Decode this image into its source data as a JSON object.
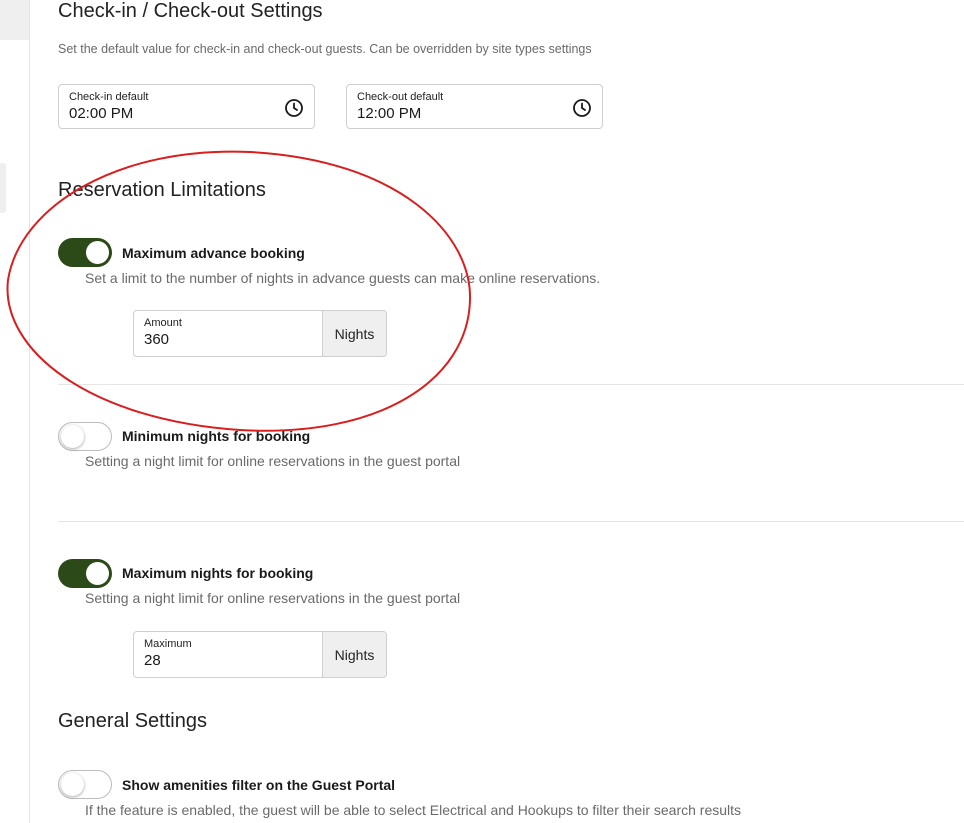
{
  "checkin_section": {
    "title": "Check-in / Check-out Settings",
    "description": "Set the default value for check-in and check-out guests. Can be overridden by site types settings",
    "checkin": {
      "label": "Check-in default",
      "value": "02:00 PM"
    },
    "checkout": {
      "label": "Check-out default",
      "value": "12:00 PM"
    }
  },
  "reservation_section": {
    "title": "Reservation Limitations",
    "max_advance": {
      "label": "Maximum advance booking",
      "description": "Set a limit to the number of nights in advance guests can make online reservations.",
      "enabled": true,
      "field_label": "Amount",
      "field_value": "360",
      "suffix": "Nights"
    },
    "min_nights": {
      "label": "Minimum nights for booking",
      "description": "Setting a night limit for online reservations in the guest portal",
      "enabled": false
    },
    "max_nights": {
      "label": "Maximum nights for booking",
      "description": "Setting a night limit for online reservations in the guest portal",
      "enabled": true,
      "field_label": "Maximum",
      "field_value": "28",
      "suffix": "Nights"
    }
  },
  "general_section": {
    "title": "General Settings",
    "amenities_filter": {
      "label": "Show amenities filter on the Guest Portal",
      "description": "If the feature is enabled, the guest will be able to select Electrical and Hookups to filter their search results",
      "enabled": false
    }
  },
  "colors": {
    "toggle_on": "#2b4a17",
    "annotation": "#d81e1e"
  },
  "icons": {
    "time": "clock-icon"
  }
}
